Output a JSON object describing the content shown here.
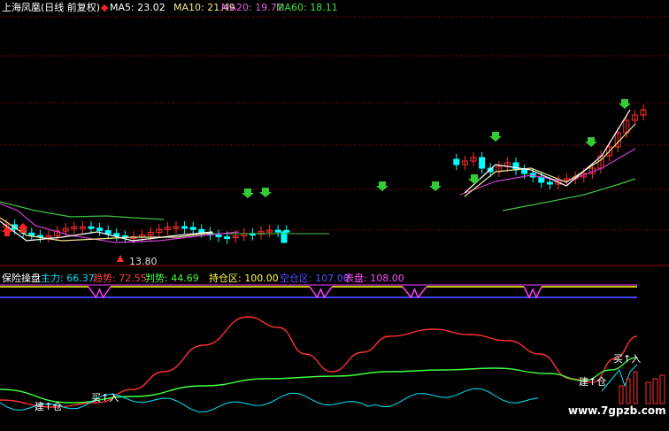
{
  "header": {
    "stock": "上海凤凰(日线 前复权)",
    "ma5": "MA5: 23.02",
    "ma10": "MA10: 21.49",
    "ma20": "MA20: 19.72",
    "ma60": "MA60: 18.11"
  },
  "low_label": "13.80",
  "indicator": {
    "name": "保险操盘",
    "zhuli": "主力: 66.37",
    "qushi": "趋势: 72.55",
    "panshi": "判势: 44.69",
    "chicang": "持仓区: 100.00",
    "kongcang": "空仓区: 107.00",
    "biaopan": "表盘: 108.00"
  },
  "signals": {
    "build1": "建↑仓",
    "buy1": "买↑入",
    "build2": "建↑仓",
    "buy2": "买↑入"
  },
  "watermark": "www.7gpzb.com",
  "colors": {
    "ma5": "#ffffff",
    "ma10": "#f0e68c",
    "ma20": "#d040d0",
    "ma60": "#40c040",
    "up": "#ff3030",
    "down": "#00ffff",
    "zhuli": "#00e5ff",
    "qushi": "#ff3030",
    "panshi": "#40ff40",
    "chicang": "#ffff00",
    "kongcang": "#4040ff",
    "biaopan": "#ff40ff"
  }
}
